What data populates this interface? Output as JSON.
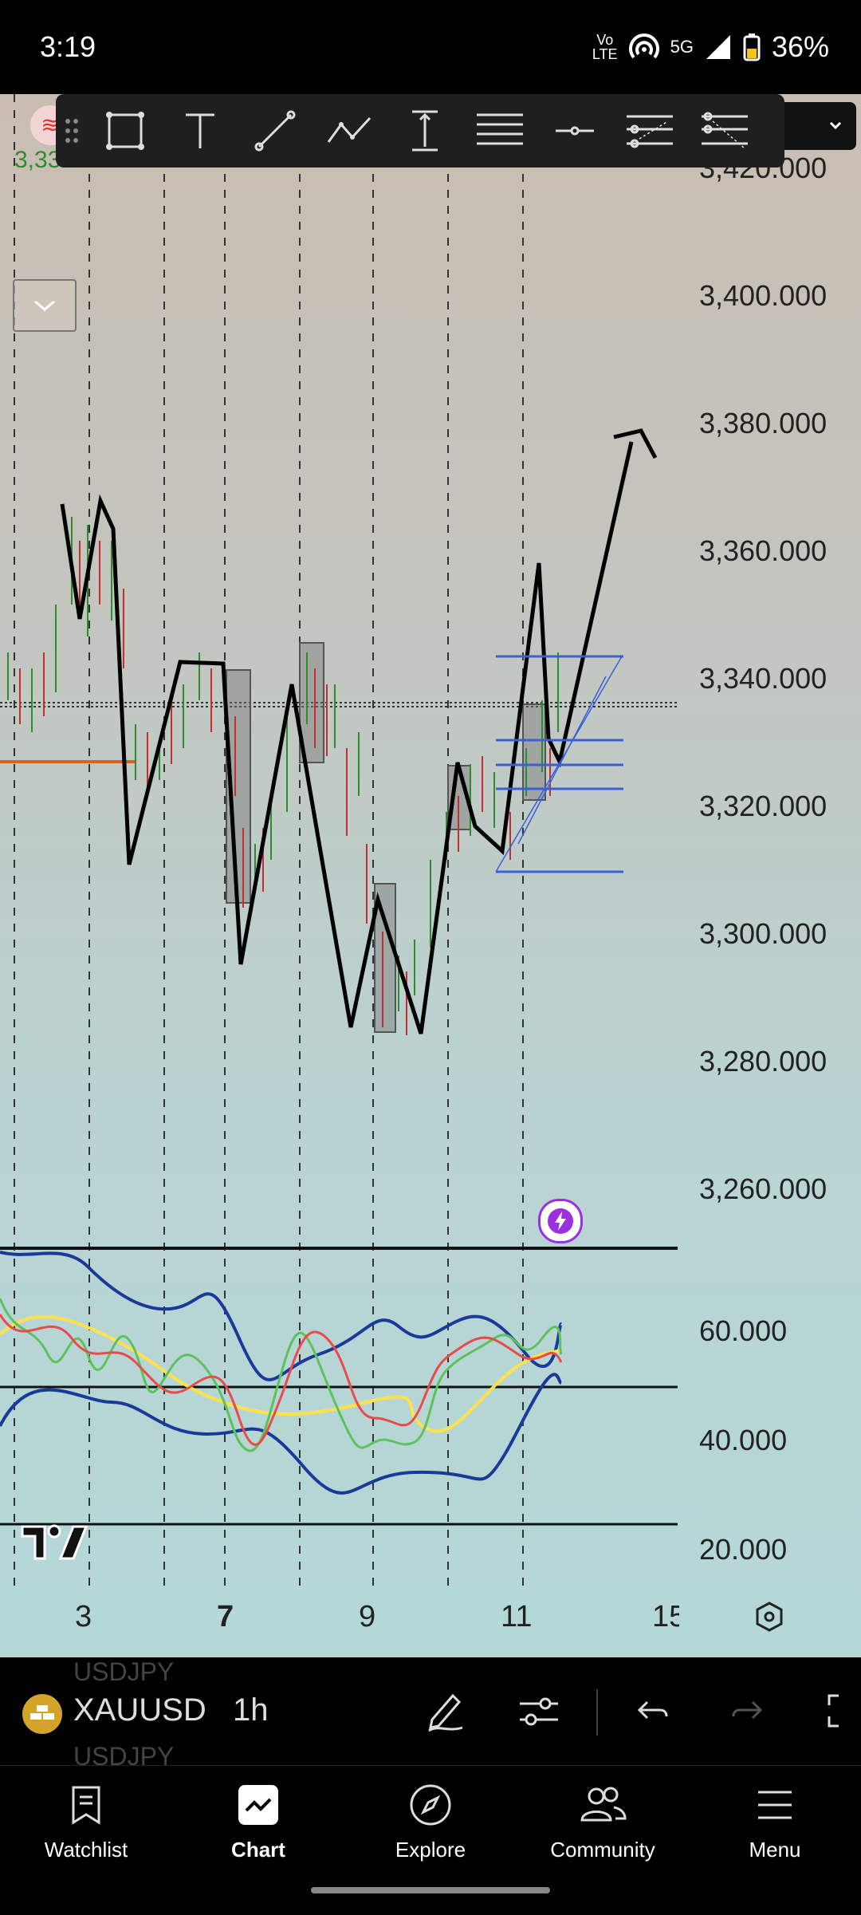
{
  "status_bar": {
    "time": "3:19",
    "volte_line1": "Vo",
    "volte_line2": "LTE",
    "network": "5G",
    "battery": "36%"
  },
  "toolbar": {
    "tools": [
      "grip-icon",
      "rectangle-icon",
      "text-icon",
      "trend-line-icon",
      "path-icon",
      "price-range-icon",
      "horizontal-lines-icon",
      "horizontal-ray-icon",
      "parallel-channel-icon",
      "regression-trend-icon"
    ]
  },
  "price_axis": {
    "labels": [
      "3,420.000",
      "3,400.000",
      "3,380.000",
      "3,360.000",
      "3,340.000",
      "3,320.000",
      "3,300.000",
      "3,280.000",
      "3,260.000"
    ]
  },
  "osc_axis": {
    "labels": [
      "60.000",
      "40.000",
      "20.000"
    ]
  },
  "date_axis": {
    "labels": [
      "3",
      "7",
      "9",
      "11",
      "15"
    ]
  },
  "symbol_info": {
    "partial_price": "3,33"
  },
  "bottom_controls": {
    "symbol": "XAUUSD",
    "symbol_ghost_above": "USDJPY",
    "symbol_ghost_below": "USDJPY",
    "interval": "1h"
  },
  "bottom_nav": [
    {
      "label": "Watchlist",
      "icon": "watchlist-icon"
    },
    {
      "label": "Chart",
      "icon": "chart-icon"
    },
    {
      "label": "Explore",
      "icon": "compass-icon"
    },
    {
      "label": "Community",
      "icon": "community-icon"
    },
    {
      "label": "Menu",
      "icon": "menu-icon"
    }
  ],
  "colors": {
    "accent_purple": "#9b30e0",
    "long_box": "#3a5fd6",
    "ema_red": "#e84b4b",
    "rsi_green": "#5cc25c",
    "signal_yellow": "#ffe24a",
    "band_blue": "#1a3a9a"
  }
}
